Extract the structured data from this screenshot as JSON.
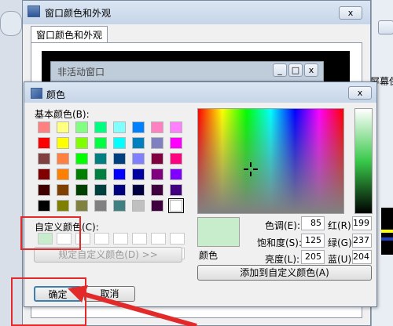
{
  "background_window": {
    "title": "窗口颜色和外观",
    "tab": "窗口颜色和外观",
    "close_label": "x",
    "right_edge_text": "屏幕保"
  },
  "inactive_preview": {
    "title": "非活动窗口",
    "min_label": "_",
    "max_label": "□",
    "close_label": "x"
  },
  "color_dialog": {
    "title": "颜色",
    "close_label": "x",
    "basic_colors_label": "基本颜色(B):",
    "basic_colors": [
      "#ff8080",
      "#ffff80",
      "#80ff80",
      "#00ff80",
      "#80ffff",
      "#0080ff",
      "#ff80c0",
      "#ff80ff",
      "#ff0000",
      "#ffff00",
      "#80ff00",
      "#00ff40",
      "#00ffff",
      "#0080c0",
      "#8080c0",
      "#ff00ff",
      "#804040",
      "#ff8040",
      "#00ff00",
      "#008080",
      "#004080",
      "#8080ff",
      "#800040",
      "#ff0080",
      "#800000",
      "#ff8000",
      "#008000",
      "#008040",
      "#0000ff",
      "#0000a0",
      "#800080",
      "#8000ff",
      "#400000",
      "#804000",
      "#004000",
      "#004040",
      "#000080",
      "#000040",
      "#400040",
      "#400080",
      "#000000",
      "#808000",
      "#808040",
      "#808080",
      "#408080",
      "#c0c0c0",
      "#400040",
      "#ffffff"
    ],
    "selected_basic_index": 47,
    "custom_colors_label": "自定义颜色(C):",
    "custom_colors": [
      "#c7edcc",
      "#ffffff",
      "#ffffff",
      "#ffffff",
      "#ffffff",
      "#ffffff",
      "#ffffff",
      "#ffffff",
      "#ffffff",
      "#ffffff",
      "#ffffff",
      "#ffffff",
      "#ffffff",
      "#ffffff",
      "#ffffff",
      "#ffffff"
    ],
    "define_custom_button": "规定自定义颜色(D) >>",
    "ok_button": "确定",
    "cancel_button": "取消",
    "add_custom_button": "添加到自定义颜色(A)",
    "preview_label": "颜色",
    "current_color": "#c7edcc",
    "fields": {
      "hue_label": "色调(E):",
      "hue": "85",
      "sat_label": "饱和度(S):",
      "sat": "125",
      "lum_label": "亮度(L):",
      "lum": "205",
      "red_label": "红(R):",
      "red": "199",
      "green_label": "绿(G):",
      "green": "237",
      "blue_label": "蓝(U):",
      "blue": "204"
    }
  },
  "colors": {
    "annotation_red": "#e22a2a",
    "dialog_face": "#f0f0f0",
    "title_gradient_top": "#dbe6f3"
  }
}
